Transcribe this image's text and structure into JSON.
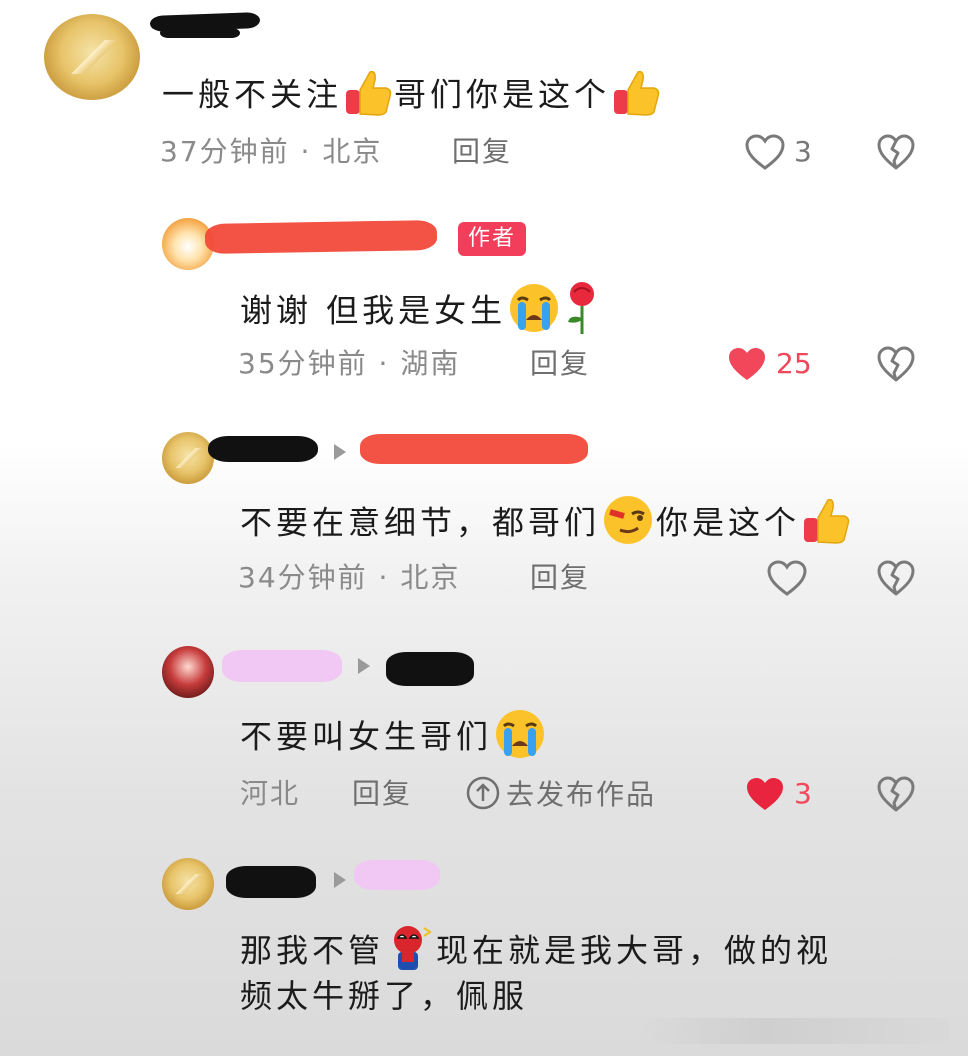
{
  "comments": [
    {
      "text_a": "一般不关注",
      "text_b": "哥们你是这个",
      "time": "37分钟前 · 北京",
      "reply": "回复",
      "likes": "3",
      "liked": false,
      "emojis": [
        "thumbs-up",
        "thumbs-up"
      ]
    },
    {
      "author_badge": "作者",
      "text_a": "谢谢 但我是女生",
      "time": "35分钟前 · 湖南",
      "reply": "回复",
      "likes": "25",
      "liked": true,
      "emojis": [
        "loudly-crying-face",
        "rose"
      ]
    },
    {
      "text_a": "不要在意细节，都哥们",
      "text_b": "你是这个",
      "time": "34分钟前 · 北京",
      "reply": "回复",
      "likes": "",
      "liked": false,
      "emojis": [
        "smirk-face",
        "thumbs-up"
      ]
    },
    {
      "text_a": "不要叫女生哥们",
      "time": "河北",
      "reply": "回复",
      "publish": "去发布作品",
      "likes": "3",
      "liked": true,
      "emojis": [
        "loudly-crying-face"
      ]
    },
    {
      "text_a": "那我不管",
      "text_b": "现在就是我大哥，做的视",
      "text_c": "频太牛掰了，佩服",
      "emojis": [
        "spiderman"
      ]
    }
  ],
  "colors": {
    "like_active": "#f2465a",
    "author_badge": "#f23e5a",
    "meta_text": "#8a8a8a"
  }
}
